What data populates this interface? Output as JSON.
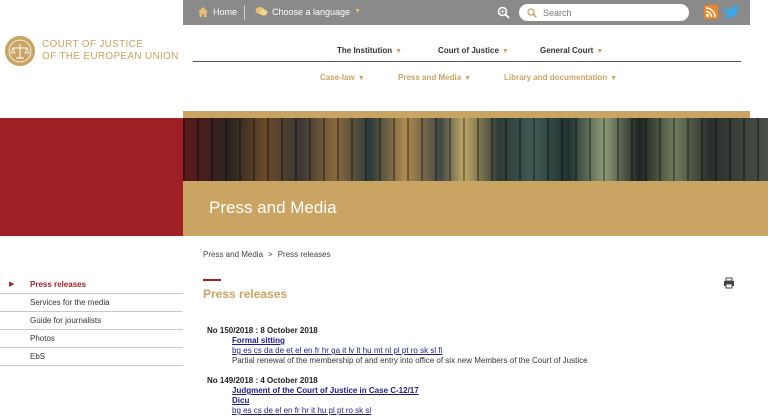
{
  "topbar": {
    "home": "Home",
    "language": "Choose a language",
    "search_placeholder": "Search"
  },
  "logo": {
    "line1": "COURT OF JUSTICE",
    "line2": "OF THE EUROPEAN UNION"
  },
  "nav": {
    "primary": [
      "The Institution",
      "Court of Justice",
      "General Court"
    ],
    "secondary": [
      "Case-law",
      "Press and Media",
      "Library and documentation"
    ]
  },
  "banner": {
    "title": "Press and Media"
  },
  "breadcrumb": {
    "parent": "Press and Media",
    "separator": ">",
    "current": "Press releases"
  },
  "sidebar": {
    "items": [
      "Press releases",
      "Services for the media",
      "Guide for journalists",
      "Photos",
      "EbS"
    ]
  },
  "content": {
    "title": "Press releases",
    "entries": [
      {
        "head": "No 150/2018 : 8 October 2018",
        "link": "Formal sitting",
        "langs": "bg es cs da de et el en fr hr ga it lv lt hu mt nl pl pt ro sk sl fi",
        "desc": "Partial renewal of the membership of and entry into office of six new Members of the Court of Justice"
      },
      {
        "head": "No 149/2018 : 4 October 2018",
        "link": "Judgment of the Court of Justice in Case C-12/17",
        "sublink": "Dicu",
        "langs": "bg es cs de el en fr hr it hu pl pt ro sk sl"
      }
    ]
  },
  "colors": {
    "gold": "#c9a462",
    "red": "#9e2025",
    "topbar": "#8a8a8a",
    "link": "#1a1a8c"
  }
}
